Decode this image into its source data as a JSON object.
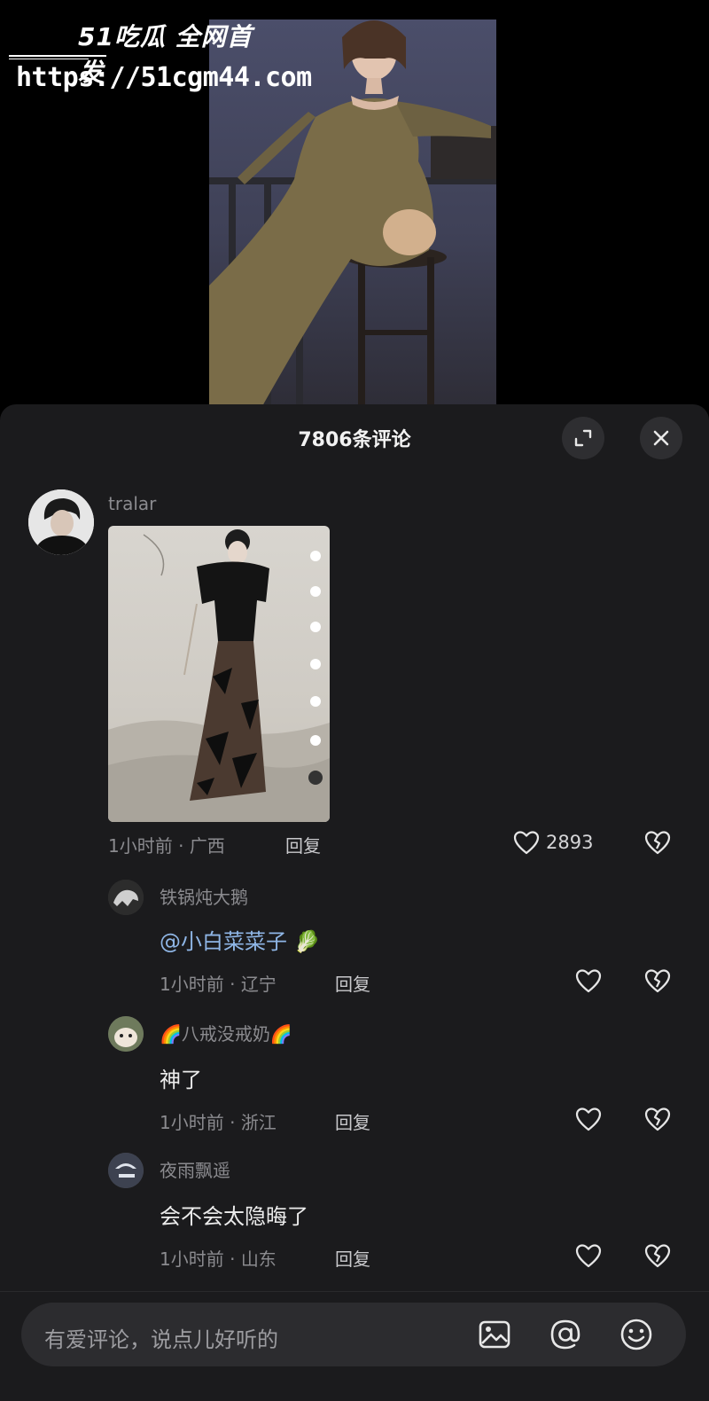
{
  "watermark": {
    "brand": "51吃瓜 全网首发",
    "url": "https://51cgm44.com"
  },
  "panel": {
    "title": "7806条评论"
  },
  "comments": [
    {
      "user": "tralar",
      "time": "1小时前",
      "sep": "·",
      "location": "广西",
      "reply": "回复",
      "likes": "2893"
    }
  ],
  "replies": [
    {
      "user": "铁锅炖大鹅",
      "mention": "@小白菜菜子",
      "emoji": "🥬",
      "time": "1小时前",
      "sep": "·",
      "location": "辽宁",
      "reply": "回复"
    },
    {
      "user_prefix": "🌈",
      "user": "八戒没戒奶",
      "user_suffix": "🌈",
      "text": "神了",
      "time": "1小时前",
      "sep": "·",
      "location": "浙江",
      "reply": "回复"
    },
    {
      "user": "夜雨飘遥",
      "text": "会不会太隐晦了",
      "time": "1小时前",
      "sep": "·",
      "location": "山东",
      "reply": "回复"
    }
  ],
  "input": {
    "placeholder": "有爱评论，说点儿好听的"
  },
  "icons": {
    "expand": "expand-icon",
    "close": "close-icon",
    "like": "heart-outline-icon",
    "dislike": "broken-heart-icon",
    "image": "image-icon",
    "mention": "at-icon",
    "emoji": "smiley-icon"
  }
}
